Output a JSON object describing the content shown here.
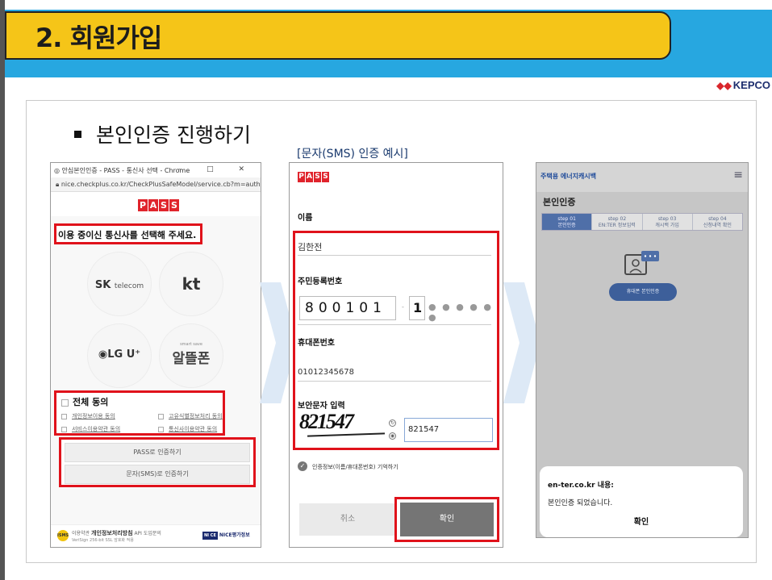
{
  "header": {
    "title": "2. 회원가입",
    "logo": "KEPCO"
  },
  "section": {
    "title": "본인인증 진행하기",
    "caption": "[문자(SMS) 인증 예시]"
  },
  "panel1": {
    "window_title": "안심본인인증 - PASS - 통신사 선택 - Chrome",
    "window_controls": "– □ ✕",
    "url": "nice.checkplus.co.kr/CheckPlusSafeModel/service.cb?m=authMobi...",
    "pass_letters": [
      "P",
      "A",
      "S",
      "S"
    ],
    "headline": "이용 중이신 통신사를 선택해 주세요.",
    "carriers": {
      "sk": "SK",
      "sk_sub": "telecom",
      "kt": "kt",
      "lgu": "◉LG U⁺",
      "alt": "알뜰폰",
      "alt_small": "smart save"
    },
    "agree_all": "전체 동의",
    "agree_items": [
      "개인정보이용 동의",
      "고유식별정보처리 동의",
      "서비스이용약관 동의",
      "통신사이용약관 동의"
    ],
    "buttons": {
      "pass": "PASS로 인증하기",
      "sms": "문자(SMS)로 인증하기"
    },
    "footer": {
      "badge": "ISMS",
      "text1_pre": "이용약관 ",
      "text1_bold": "개인정보처리방침",
      "text1_post": " API 도입문의",
      "text2": "VeriSign 256-bit SSL 암호화 적용",
      "nice_mark": "NI CE",
      "nice": "NICE평가정보"
    }
  },
  "panel2": {
    "pass_letters": [
      "P",
      "A",
      "S",
      "S"
    ],
    "name_label": "이름",
    "name_value": "김한전",
    "id_label": "주민등록번호",
    "id_front": "800101",
    "id_dash": "-",
    "id_back": "1",
    "id_mask": "● ● ● ● ● ●",
    "phone_label": "휴대폰번호",
    "phone_value": "01012345678",
    "captcha_label": "보안문자 입력",
    "captcha_image_text": "821547",
    "captcha_input": "821547",
    "captcha_icons": [
      "↻",
      "◉"
    ],
    "remember_label": "인증정보(이름/휴대폰번호) 기억하기",
    "cancel": "취소",
    "confirm": "확인"
  },
  "panel3": {
    "brand": "주택용 에너지캐시백",
    "menu_icon": "≡",
    "title": "본인인증",
    "steps": [
      {
        "num": "step 01",
        "label": "본인인증"
      },
      {
        "num": "step 02",
        "label": "EN:TER 정보입력"
      },
      {
        "num": "step 03",
        "label": "캐시백 가입"
      },
      {
        "num": "step 04",
        "label": "신청내역 확인"
      }
    ],
    "auth_button": "휴대폰 본인인증",
    "dialog": {
      "title": "en-ter.co.kr 내용:",
      "message": "본인인증 되었습니다.",
      "ok": "확인"
    }
  },
  "colors": {
    "header_band": "#27a7e0",
    "header_gold": "#f5c518",
    "highlight": "#e0121b",
    "pass_red": "#e0242c"
  }
}
